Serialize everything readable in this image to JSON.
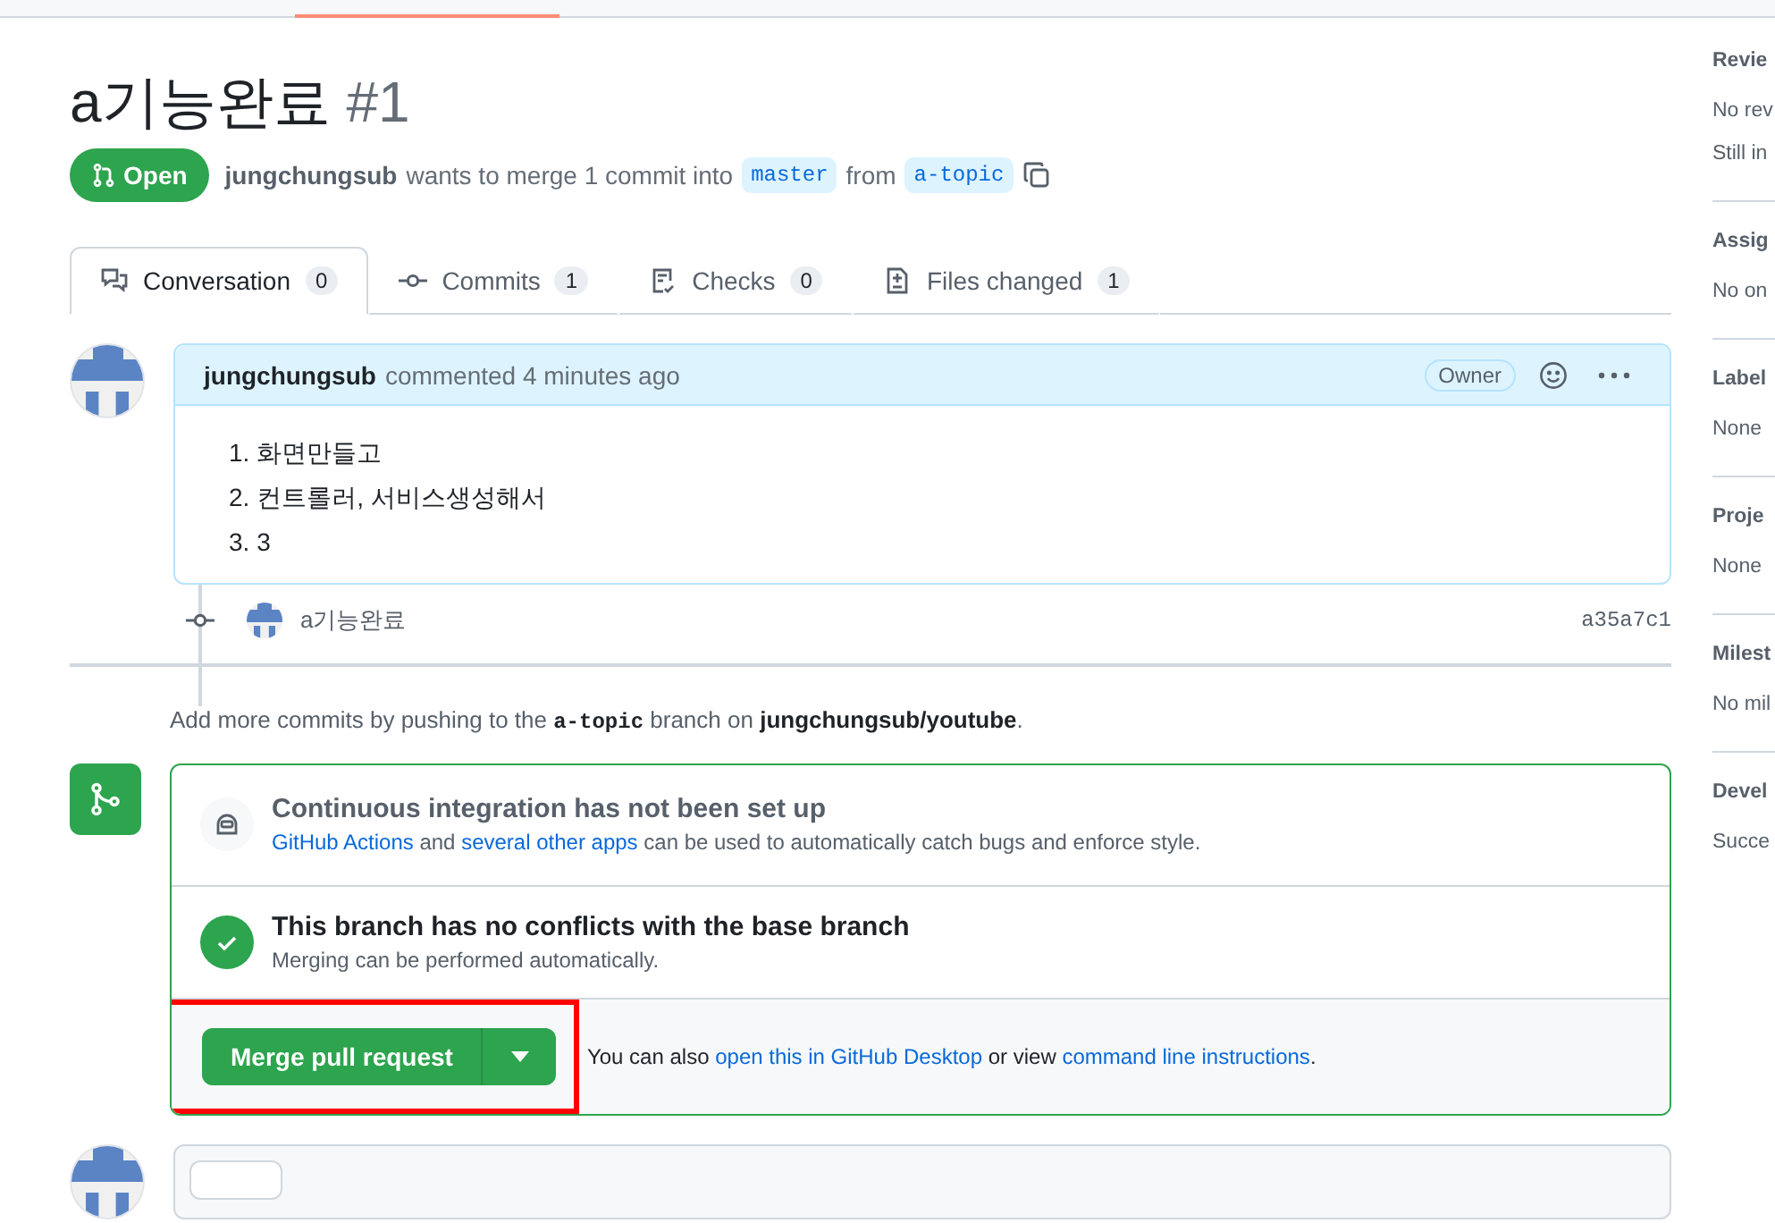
{
  "title": "a기능완료",
  "number": "#1",
  "state": {
    "kind": "open",
    "label": "Open"
  },
  "summary": {
    "author": "jungchungsub",
    "text_1": "wants to merge 1 commit into",
    "base": "master",
    "text_2": "from",
    "head": "a-topic"
  },
  "tabs": [
    {
      "kind": "conversation",
      "label": "Conversation",
      "count": "0",
      "selected": true
    },
    {
      "kind": "commits",
      "label": "Commits",
      "count": "1",
      "selected": false
    },
    {
      "kind": "checks",
      "label": "Checks",
      "count": "0",
      "selected": false
    },
    {
      "kind": "files",
      "label": "Files changed",
      "count": "1",
      "selected": false
    }
  ],
  "comment": {
    "author": "jungchungsub",
    "action": "commented 4 minutes ago",
    "badge": "Owner",
    "items": [
      "1. 화면만들고",
      "2. 컨트롤러, 서비스생성해서",
      "3. 3"
    ]
  },
  "commit": {
    "message": "a기능완료",
    "sha": "a35a7c1"
  },
  "push_hint": {
    "text_1": "Add more commits by pushing to the",
    "branch": "a-topic",
    "text_2": "branch on",
    "repo": "jungchungsub/youtube",
    "text_3": "."
  },
  "ci": {
    "title": "Continuous integration has not been set up",
    "link_1": "GitHub Actions",
    "text_1": "and",
    "link_2": "several other apps",
    "text_2": "can be used to automatically catch bugs and enforce style."
  },
  "conflicts": {
    "title": "This branch has no conflicts with the base branch",
    "subtitle": "Merging can be performed automatically."
  },
  "merge": {
    "button": "Merge pull request",
    "highlighted": true,
    "text_1": "You can also",
    "link_1": "open this in GitHub Desktop",
    "text_2": "or view",
    "link_2": "command line instructions",
    "text_3": "."
  },
  "sidebar": [
    {
      "heading": "Revie",
      "lines": [
        "No rev",
        "Still in"
      ]
    },
    {
      "heading": "Assig",
      "lines": [
        "No on"
      ]
    },
    {
      "heading": "Label",
      "lines": [
        "None"
      ]
    },
    {
      "heading": "Proje",
      "lines": [
        "None"
      ]
    },
    {
      "heading": "Milest",
      "lines": [
        "No mil"
      ]
    },
    {
      "heading": "Devel",
      "lines": [
        "Succe"
      ]
    }
  ]
}
